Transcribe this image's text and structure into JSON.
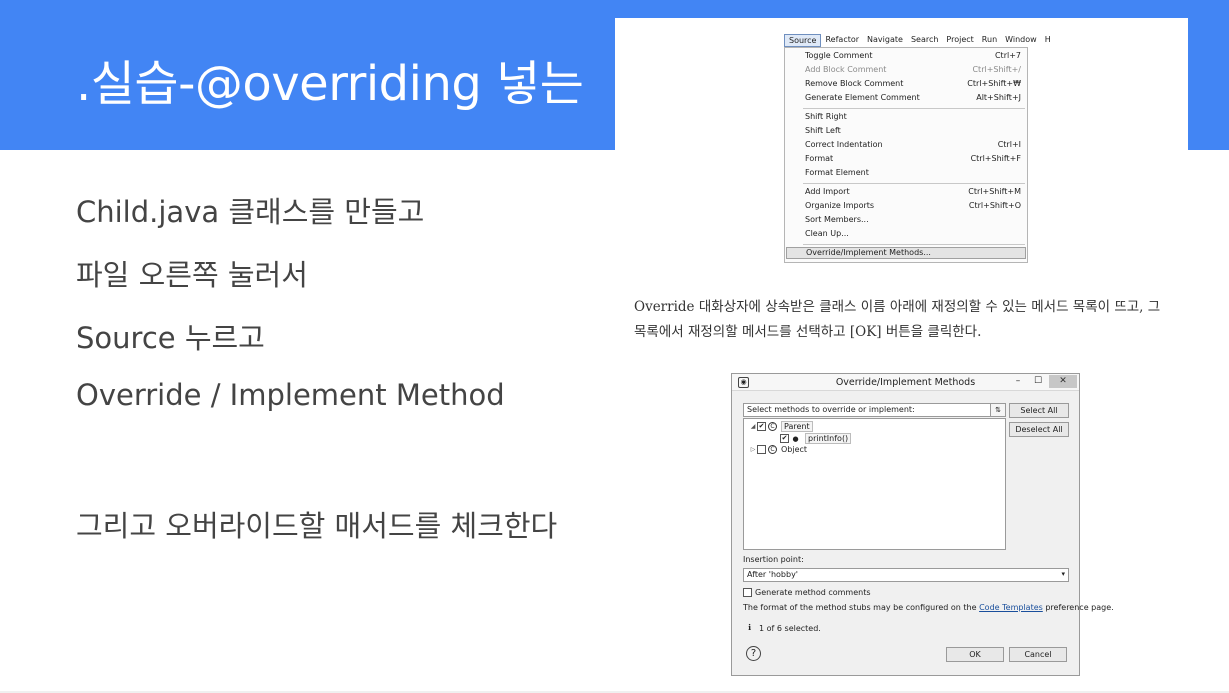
{
  "slide": {
    "title": ".실습-@overriding 넣는",
    "bullets": [
      "Child.java 클래스를 만들고",
      "파일 오른쪽 눌러서",
      "Source 누르고",
      "Override / Implement Method",
      "그리고 오버라이드할 매서드를 체크한다"
    ],
    "accent_color": "#4285f4"
  },
  "menu_screenshot": {
    "menubar": [
      "Source",
      "Refactor",
      "Navigate",
      "Search",
      "Project",
      "Run",
      "Window",
      "H"
    ],
    "items": [
      {
        "label": "Toggle Comment",
        "shortcut": "Ctrl+7"
      },
      {
        "label": "Add Block Comment",
        "shortcut": "Ctrl+Shift+/"
      },
      {
        "label": "Remove Block Comment",
        "shortcut": "Ctrl+Shift+₩"
      },
      {
        "label": "Generate Element Comment",
        "shortcut": "Alt+Shift+J"
      },
      {
        "label": "Shift Right",
        "shortcut": ""
      },
      {
        "label": "Shift Left",
        "shortcut": ""
      },
      {
        "label": "Correct Indentation",
        "shortcut": "Ctrl+I"
      },
      {
        "label": "Format",
        "shortcut": "Ctrl+Shift+F"
      },
      {
        "label": "Format Element",
        "shortcut": ""
      },
      {
        "label": "Add Import",
        "shortcut": "Ctrl+Shift+M"
      },
      {
        "label": "Organize Imports",
        "shortcut": "Ctrl+Shift+O"
      },
      {
        "label": "Sort Members...",
        "shortcut": ""
      },
      {
        "label": "Clean Up...",
        "shortcut": ""
      },
      {
        "label": "Override/Implement Methods...",
        "shortcut": ""
      }
    ]
  },
  "caption": {
    "line1": "Override 대화상자에 상속받은 클래스 이름 아래에 재정의할 수 있는 메서드 목록이 뜨고, 그",
    "line2": "목록에서 재정의할 메서드를 선택하고 [OK] 버튼을 클릭한다."
  },
  "dialog": {
    "title": "Override/Implement Methods",
    "win_minimize": "–",
    "win_maximize": "☐",
    "win_close": "✕",
    "filter_placeholder": "Select methods to override or implement:",
    "tree": [
      {
        "label": "Parent",
        "checked": "✔",
        "toggle": "◢"
      },
      {
        "label": "printInfo()",
        "checked": "✔",
        "icon": "●"
      },
      {
        "label": "Object",
        "checked": "",
        "toggle": "▷"
      }
    ],
    "select_all": "Select All",
    "deselect_all": "Deselect All",
    "insertion_label": "Insertion point:",
    "insertion_value": "After 'hobby'",
    "generate_comments": "Generate method comments",
    "format_note_pre": "The format of the method stubs may be configured on the ",
    "format_note_link": "Code Templates",
    "format_note_post": " preference page.",
    "info_icon": "ℹ",
    "status": "1 of 6 selected.",
    "help": "?",
    "ok": "OK",
    "cancel": "Cancel"
  }
}
